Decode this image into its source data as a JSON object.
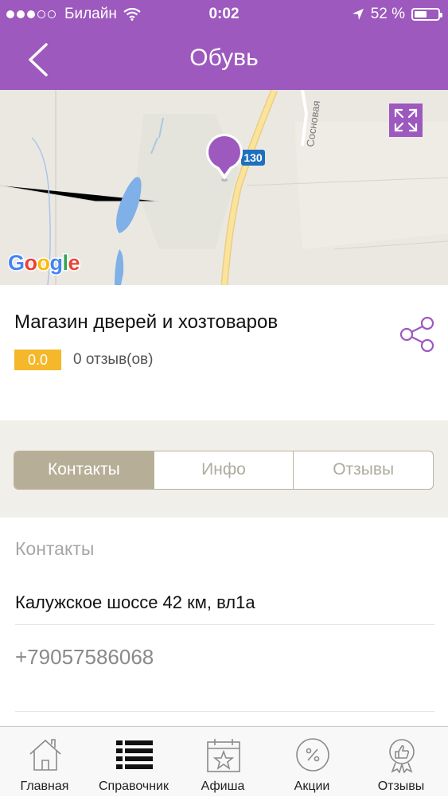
{
  "status_bar": {
    "carrier": "Билайн",
    "time": "0:02",
    "battery": "52 %",
    "battery_level": 0.52
  },
  "header": {
    "title": "Обувь",
    "accent_color": "#9d59be"
  },
  "map": {
    "road_label": "130",
    "street_label": "Сосновая",
    "google_logo": "Google"
  },
  "place": {
    "name": "Магазин дверей и хозтоваров",
    "rating": "0.0",
    "reviews": "0 отзыв(ов)"
  },
  "tabs": [
    {
      "label": "Контакты",
      "active": true
    },
    {
      "label": "Инфо",
      "active": false
    },
    {
      "label": "Отзывы",
      "active": false
    }
  ],
  "contacts": {
    "header": "Контакты",
    "address": "Калужское шоссе 42 км, вл1а",
    "phone": "+79057586068"
  },
  "tabbar": [
    {
      "label": "Главная",
      "icon": "home-icon"
    },
    {
      "label": "Справочник",
      "icon": "list-icon"
    },
    {
      "label": "Афиша",
      "icon": "calendar-star-icon"
    },
    {
      "label": "Акции",
      "icon": "percent-icon"
    },
    {
      "label": "Отзывы",
      "icon": "thumbs-up-badge-icon"
    }
  ]
}
